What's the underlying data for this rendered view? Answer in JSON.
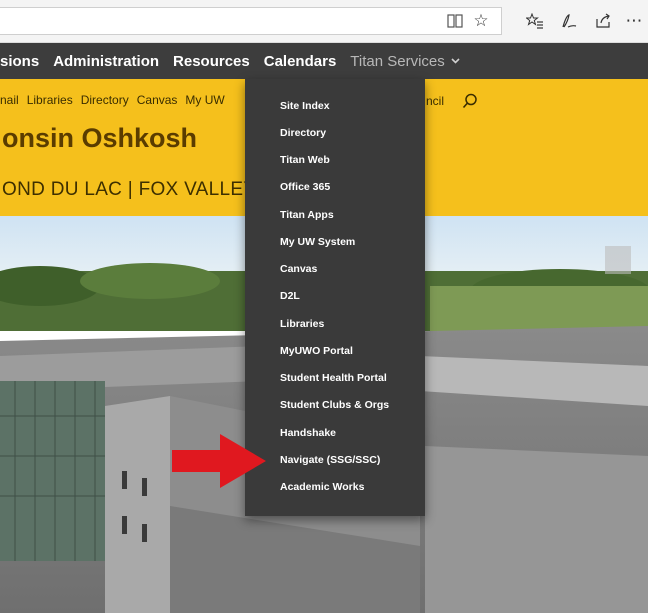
{
  "browser": {
    "icons": [
      "reading-view-icon",
      "favorite-star-icon",
      "favorites-list-icon",
      "pen-icon",
      "share-icon",
      "more-icon"
    ]
  },
  "nav": {
    "items": [
      "sions",
      "Administration",
      "Resources",
      "Calendars"
    ],
    "titan_services": "Titan Services"
  },
  "banner": {
    "quick_links": [
      "nail",
      "Libraries",
      "Directory",
      "Canvas",
      "My UW"
    ],
    "right_link": "ncil",
    "title": "onsin Oshkosh",
    "subtitle": "OND DU LAC | FOX VALLEY"
  },
  "dropdown": {
    "items": [
      "Site Index",
      "Directory",
      "Titan Web",
      "Office 365",
      "Titan Apps",
      "My UW System",
      "Canvas",
      "D2L",
      "Libraries",
      "MyUWO Portal",
      "Student Health Portal",
      "Student Clubs & Orgs",
      "Handshake",
      "Navigate (SSG/SSC)",
      "Academic Works"
    ]
  },
  "colors": {
    "nav_bg": "#3d3d3d",
    "banner": "#f5c01c",
    "dropdown_bg": "#3a3a3a",
    "arrow": "#e0181f"
  }
}
